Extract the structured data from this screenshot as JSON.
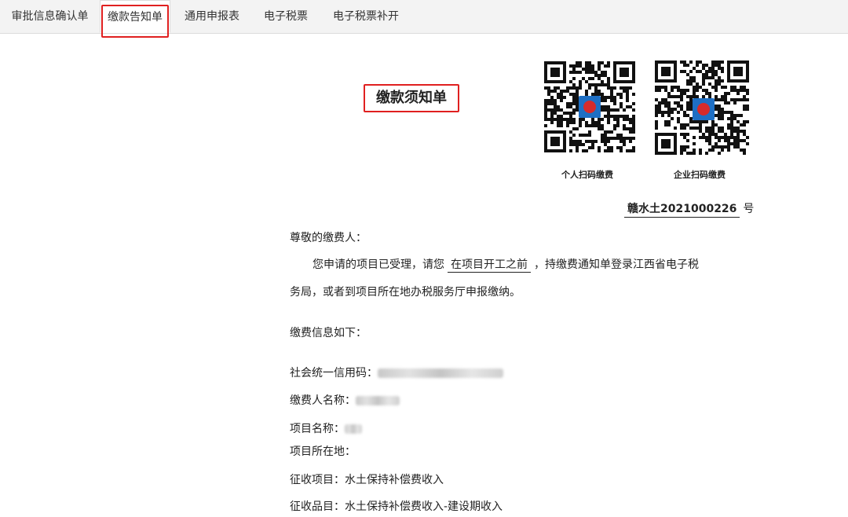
{
  "tabs": [
    {
      "label": "审批信息确认单"
    },
    {
      "label": "缴款告知单"
    },
    {
      "label": "通用申报表"
    },
    {
      "label": "电子税票"
    },
    {
      "label": "电子税票补开"
    }
  ],
  "document": {
    "title": "缴款须知单",
    "qr_personal_label": "个人扫码缴费",
    "qr_enterprise_label": "企业扫码缴费",
    "doc_number": "赣水土2021000226",
    "doc_number_suffix": "号",
    "greeting": "尊敬的缴费人：",
    "notice_prefix": "您申请的项目已受理，请您",
    "notice_deadline": "在项目开工之前",
    "notice_suffix": "，持缴费通知单登录江西省电子税",
    "notice_line2": "务局，或者到项目所在地办税服务厅申报缴纳。",
    "info_header": "缴费信息如下：",
    "credit_code_label": "社会统一信用码：",
    "payer_name_label": "缴费人名称：",
    "project_name_label": "项目名称：",
    "project_location_label": "项目所在地：",
    "levy_item_label": "征收项目：",
    "levy_item_value": "水土保持补偿费收入",
    "levy_subitem_label": "征收品目：",
    "levy_subitem_value": "水土保持补偿费收入-建设期收入"
  },
  "colors": {
    "highlight": "#e02020",
    "emblem_blue": "#1e6fc4",
    "emblem_red": "#d62b2b"
  }
}
